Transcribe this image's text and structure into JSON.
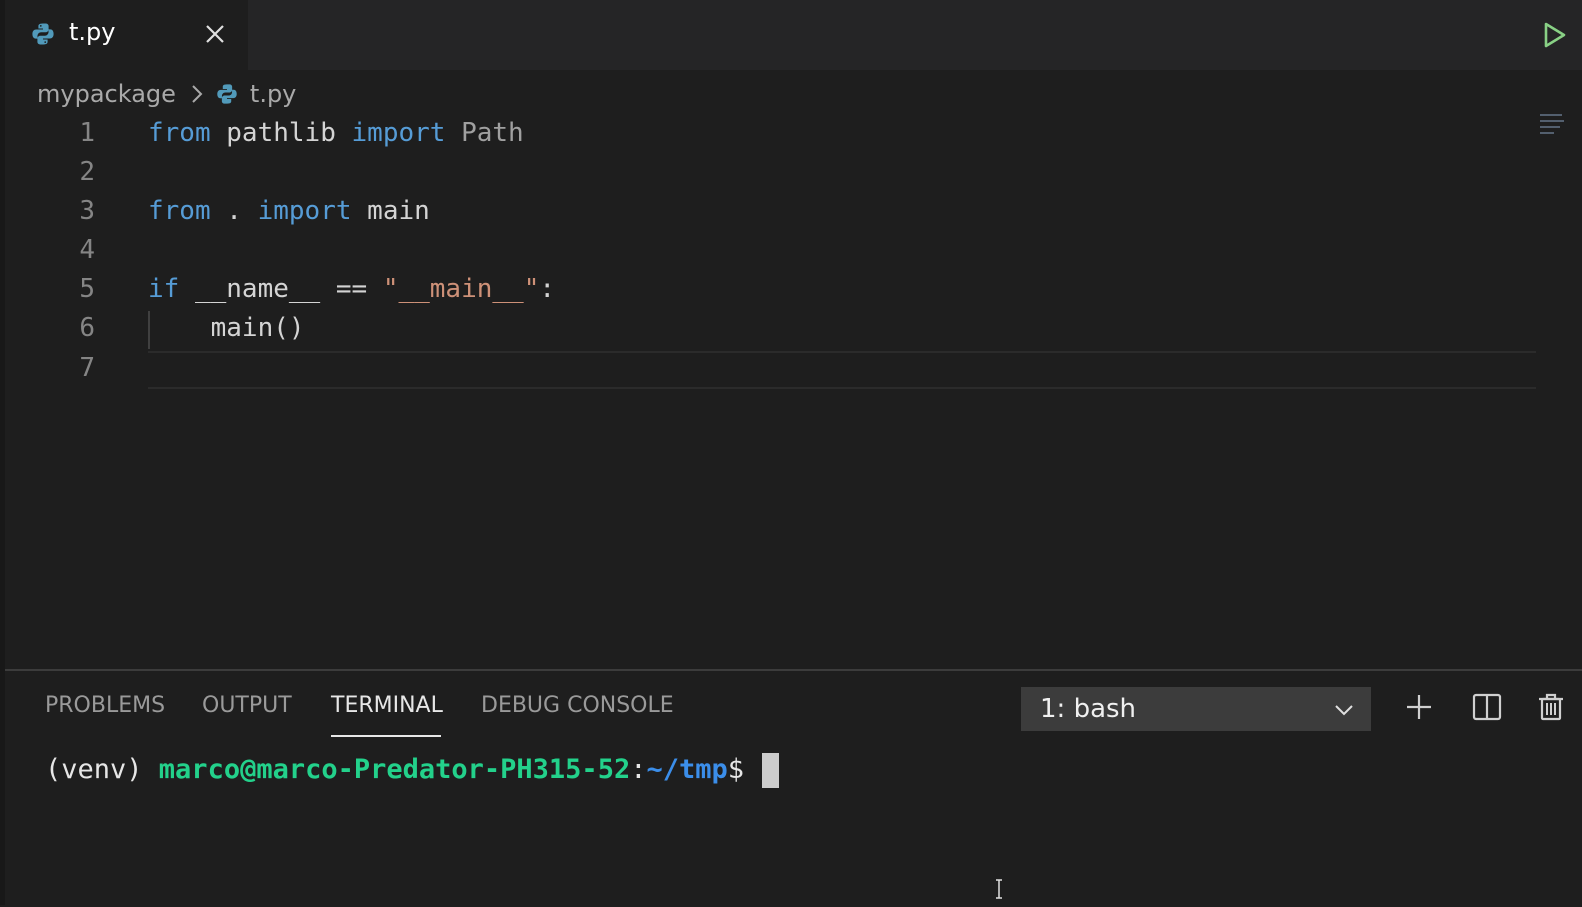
{
  "editor_tab": {
    "filename": "t.py",
    "icon": "python-icon",
    "close_icon": "close-icon"
  },
  "toolbar": {
    "run_icon": "run-play-icon"
  },
  "breadcrumb": {
    "folder": "mypackage",
    "file": "t.py"
  },
  "code_lines": [
    {
      "num": "1",
      "tokens": [
        {
          "t": "from",
          "k": "kw"
        },
        {
          "t": " pathlib ",
          "k": ""
        },
        {
          "t": "import",
          "k": "kw"
        },
        {
          "t": " ",
          "k": ""
        },
        {
          "t": "Path",
          "k": "cls"
        }
      ]
    },
    {
      "num": "2",
      "tokens": []
    },
    {
      "num": "3",
      "tokens": [
        {
          "t": "from",
          "k": "kw"
        },
        {
          "t": " . ",
          "k": ""
        },
        {
          "t": "import",
          "k": "kw"
        },
        {
          "t": " main",
          "k": ""
        }
      ]
    },
    {
      "num": "4",
      "tokens": []
    },
    {
      "num": "5",
      "tokens": [
        {
          "t": "if",
          "k": "kw"
        },
        {
          "t": " __name__ == ",
          "k": ""
        },
        {
          "t": "\"__main__\"",
          "k": "str"
        },
        {
          "t": ":",
          "k": ""
        }
      ]
    },
    {
      "num": "6",
      "tokens": [
        {
          "t": "    main()",
          "k": ""
        }
      ]
    },
    {
      "num": "7",
      "tokens": []
    }
  ],
  "panel": {
    "tabs": [
      "PROBLEMS",
      "OUTPUT",
      "TERMINAL",
      "DEBUG CONSOLE"
    ],
    "active_tab": "TERMINAL",
    "terminal_selector": "1: bash",
    "icons": [
      "plus-icon",
      "split-terminal-icon",
      "trash-icon"
    ]
  },
  "terminal": {
    "venv": "(venv) ",
    "user_host": "marco@marco-Predator-PH315-52",
    "colon": ":",
    "path": "~/tmp",
    "prompt": "$ "
  },
  "colors": {
    "keyword": "#569cd6",
    "string": "#ce9178",
    "terminal_user": "#23d18b",
    "terminal_path": "#3b8eea",
    "run_button": "#89d185"
  }
}
